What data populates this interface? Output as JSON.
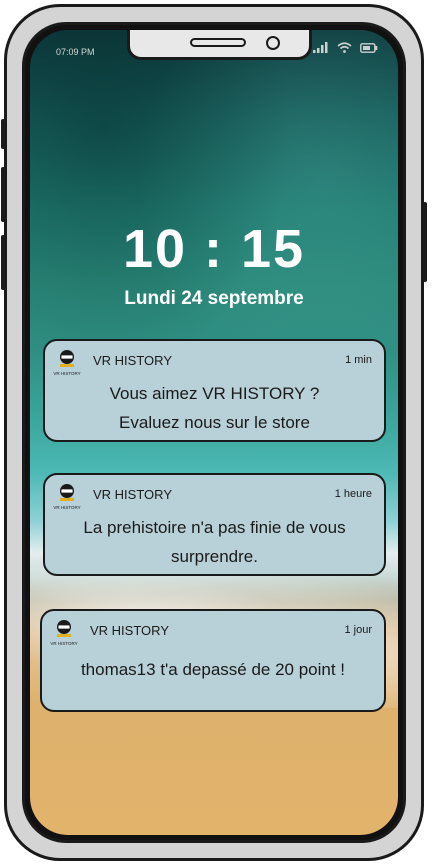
{
  "status_bar": {
    "time": "07:09 PM",
    "icons": [
      "signal-icon",
      "wifi-icon",
      "battery-icon"
    ]
  },
  "lock_screen": {
    "clock": "10 : 15",
    "date": "Lundi 24 septembre"
  },
  "notifications": [
    {
      "app": "VR HISTORY",
      "icon_label": "VR HISTORY",
      "time": "1 min",
      "lines": [
        "Vous aimez VR HISTORY ?",
        "Evaluez nous sur le store"
      ]
    },
    {
      "app": "VR HISTORY",
      "icon_label": "VR HISTORY",
      "time": "1 heure",
      "lines": [
        "La prehistoire n'a pas finie de vous",
        "surprendre."
      ]
    },
    {
      "app": "VR HISTORY",
      "icon_label": "VR HISTORY",
      "time": "1 jour",
      "lines": [
        "thomas13 t'a depassé de 20 point !"
      ]
    }
  ],
  "colors": {
    "notification_bg": "#b8d0d8",
    "frame": "#1a1a1a",
    "clock_text": "#ffffff"
  }
}
